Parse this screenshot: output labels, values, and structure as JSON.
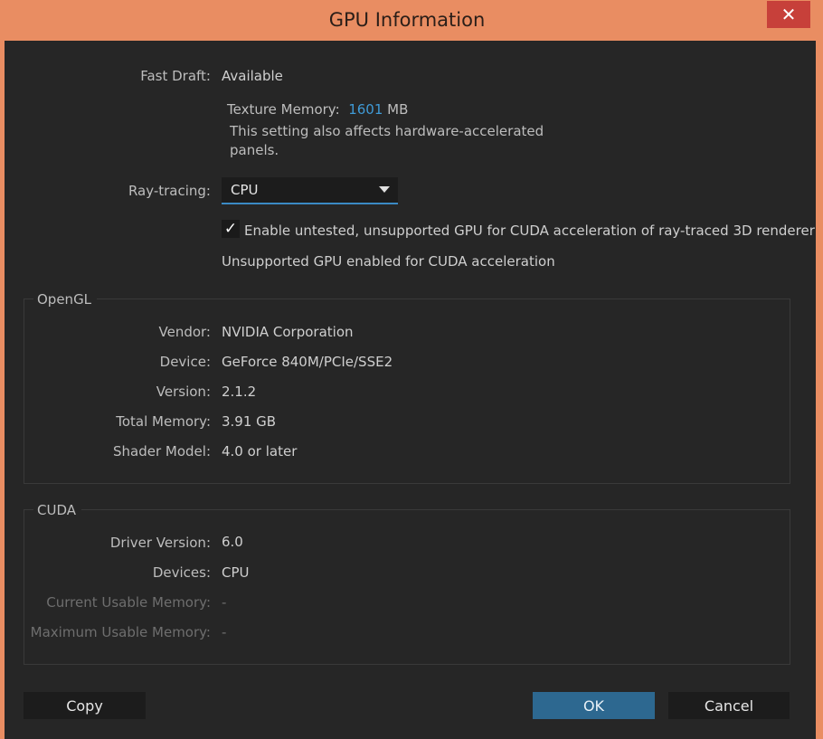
{
  "window": {
    "title": "GPU Information",
    "close_glyph": "✕"
  },
  "fast_draft": {
    "label": "Fast Draft:",
    "value": "Available"
  },
  "texture_memory": {
    "label": "Texture Memory:",
    "value": "1601",
    "unit": "MB",
    "note_line1": "This setting also affects hardware-accelerated",
    "note_line2": "panels."
  },
  "ray_tracing": {
    "label": "Ray-tracing:",
    "selected": "CPU",
    "checkbox_label": "Enable untested, unsupported GPU for CUDA acceleration of ray-traced 3D renderer",
    "checkbox_checked": true,
    "checkbox_glyph": "✓",
    "status": "Unsupported GPU enabled for CUDA acceleration"
  },
  "opengl": {
    "title": "OpenGL",
    "rows": [
      {
        "label": "Vendor:",
        "value": "NVIDIA Corporation"
      },
      {
        "label": "Device:",
        "value": "GeForce 840M/PCIe/SSE2"
      },
      {
        "label": "Version:",
        "value": "2.1.2"
      },
      {
        "label": "Total Memory:",
        "value": "3.91 GB"
      },
      {
        "label": "Shader Model:",
        "value": "4.0 or later"
      }
    ]
  },
  "cuda": {
    "title": "CUDA",
    "rows": [
      {
        "label": "Driver Version:",
        "value": "6.0"
      },
      {
        "label": "Devices:",
        "value": "CPU"
      },
      {
        "label": "Current Usable Memory:",
        "value": "-"
      },
      {
        "label": "Maximum Usable Memory:",
        "value": "-"
      }
    ]
  },
  "buttons": {
    "copy": "Copy",
    "ok": "OK",
    "cancel": "Cancel"
  }
}
